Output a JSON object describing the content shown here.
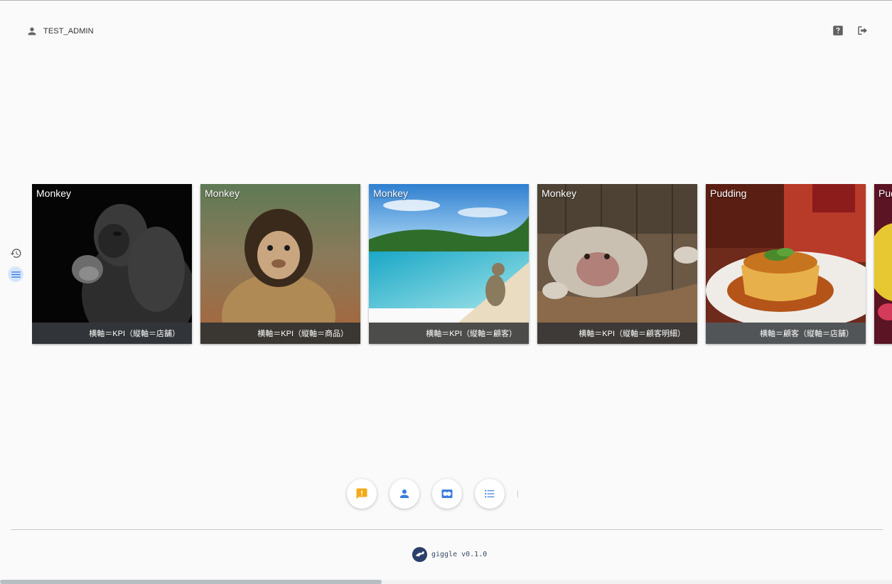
{
  "user": {
    "name": "TEST_ADMIN",
    "icon": "account-icon"
  },
  "header_actions": [
    {
      "name": "help-button",
      "icon": "help-icon"
    },
    {
      "name": "logout-button",
      "icon": "logout-icon"
    }
  ],
  "side_tools": [
    {
      "name": "history-button",
      "icon": "history-icon",
      "active": false
    },
    {
      "name": "menu-button",
      "icon": "menu-icon",
      "active": true
    }
  ],
  "cards": [
    {
      "title": "Monkey",
      "caption": "横軸＝KPI（縦軸＝店舗）",
      "image": "gorilla"
    },
    {
      "title": "Monkey",
      "caption": "横軸＝KPI（縦軸＝商品）",
      "image": "capuchin-monkey"
    },
    {
      "title": "Monkey",
      "caption": "横軸＝KPI（縦軸＝顧客）",
      "image": "monkey-on-beach"
    },
    {
      "title": "Monkey",
      "caption": "横軸＝KPI（縦軸＝顧客明細）",
      "image": "baboon-in-barrel"
    },
    {
      "title": "Pudding",
      "caption": "横軸＝顧客（縦軸＝店舗）",
      "image": "custard-pudding"
    },
    {
      "title": "Pud",
      "caption": "",
      "image": "dessert-partial"
    }
  ],
  "bottom_actions": [
    {
      "name": "feedback-button",
      "icon": "feedback-icon",
      "color": "#f4a916"
    },
    {
      "name": "customer-button",
      "icon": "person-icon",
      "color": "#3b7ddd"
    },
    {
      "name": "analysis-button",
      "icon": "dual-circle-icon",
      "color": "#3b7ddd"
    },
    {
      "name": "list-button",
      "icon": "list-icon",
      "color": "#3b7ddd"
    }
  ],
  "footer": {
    "logo": "giggle-logo-icon",
    "text": "giggle v0.1.0"
  },
  "colors": {
    "accent": "#3b7ddd",
    "warning": "#f4a916",
    "background": "#fafafa"
  }
}
